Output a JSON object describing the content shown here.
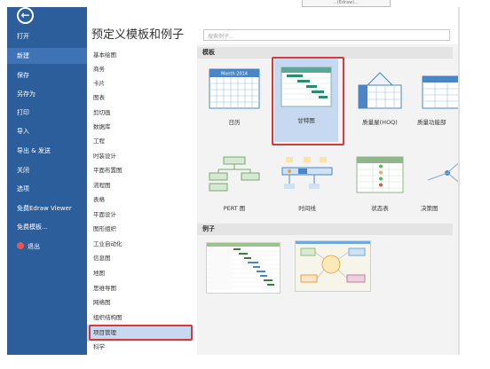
{
  "top_snippet": "...(Edraw)...",
  "nav": {
    "items": [
      "打开",
      "新建",
      "保存",
      "另存为",
      "打印",
      "导入",
      "导出 & 发送",
      "关闭",
      "选项",
      "免费Edraw Viewer",
      "免费模板...",
      "退出"
    ],
    "active": "新建"
  },
  "page_title": "预定义模板和例子",
  "search": {
    "placeholder": "搜索例子..."
  },
  "categories": [
    "基本绘图",
    "商务",
    "卡片",
    "图表",
    "剪切画",
    "数据库",
    "工程",
    "时装设计",
    "平面布置图",
    "流程图",
    "表格",
    "平面设计",
    "图形组织",
    "工业自动化",
    "信息图",
    "地图",
    "思维导图",
    "网络图",
    "组织结构图",
    "项目管理",
    "科学"
  ],
  "selected_category": "项目管理",
  "sections": {
    "templates": "模板",
    "examples": "例子"
  },
  "templates": [
    {
      "label": "日历",
      "icon": "calendar-thumb-icon"
    },
    {
      "label": "甘特图",
      "icon": "gantt-thumb-icon"
    },
    {
      "label": "质量屋(HOQ)",
      "icon": "hoq-thumb-icon"
    },
    {
      "label": "质量功能部",
      "icon": "qfd-thumb-icon"
    },
    {
      "label": "PERT 图",
      "icon": "pert-thumb-icon"
    },
    {
      "label": "时间线",
      "icon": "timeline-thumb-icon"
    },
    {
      "label": "状态表",
      "icon": "status-table-thumb-icon"
    },
    {
      "label": "决策图",
      "icon": "decision-thumb-icon"
    }
  ],
  "calendar_header": "Month 2014",
  "examples": [
    "gantt-example-icon",
    "project-map-example-icon"
  ],
  "colors": {
    "nav_bg": "#2c5e9c",
    "accent": "#d33b3b",
    "selected": "#c6d9f1"
  }
}
